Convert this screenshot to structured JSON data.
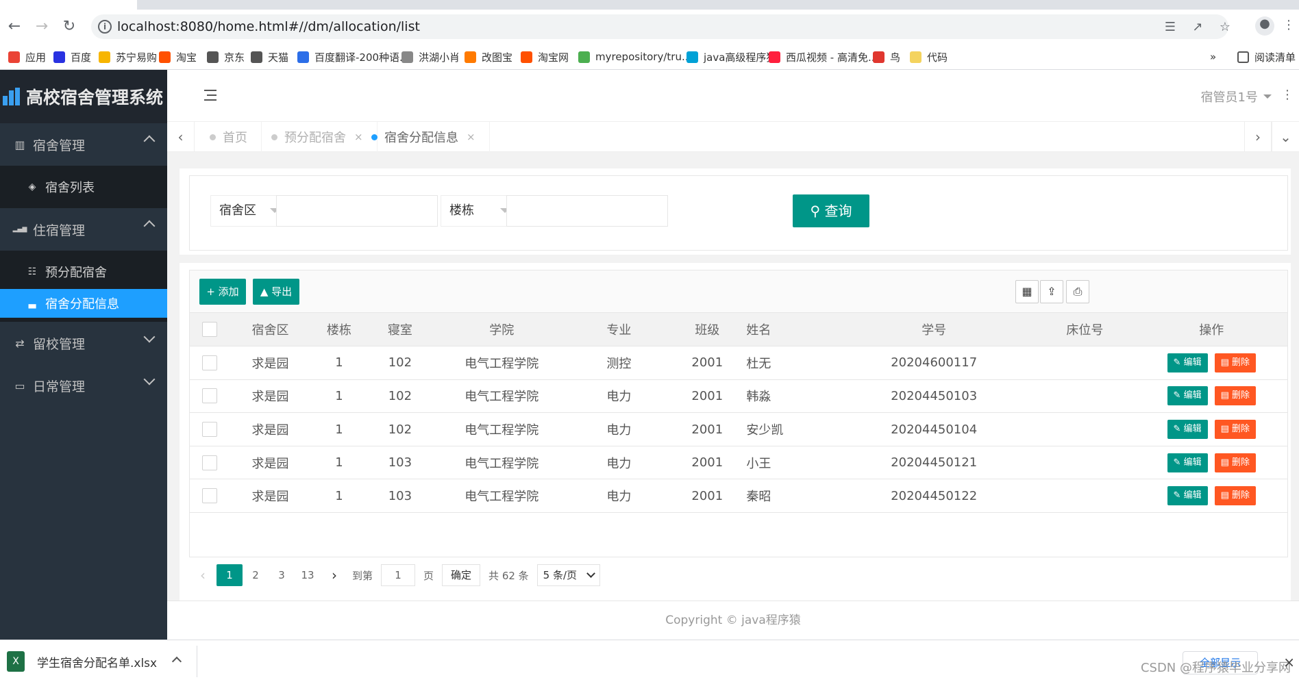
{
  "browser": {
    "url": "localhost:8080/home.html#//dm/allocation/list",
    "bookmarks": [
      {
        "label": "应用",
        "color": "#ea4335"
      },
      {
        "label": "百度",
        "color": "#2932e1"
      },
      {
        "label": "苏宁易购",
        "color": "#f7b500"
      },
      {
        "label": "淘宝",
        "color": "#ff5000"
      },
      {
        "label": "京东",
        "color": "#555555"
      },
      {
        "label": "天猫",
        "color": "#555555"
      },
      {
        "label": "百度翻译-200种语...",
        "color": "#2c6ee8"
      },
      {
        "label": "洪湖小肖",
        "color": "#888888"
      },
      {
        "label": "改图宝",
        "color": "#ff7a00"
      },
      {
        "label": "淘宝网",
        "color": "#ff5000"
      },
      {
        "label": "myrepository/tru...",
        "color": "#4caf50"
      },
      {
        "label": "java高级程序猿",
        "color": "#00a1d6"
      },
      {
        "label": "西瓜视频 - 高清免...",
        "color": "#ff1f3d"
      },
      {
        "label": "鸟",
        "color": "#e0372f"
      },
      {
        "label": "代码",
        "color": "#f4d35e"
      }
    ],
    "bookmarks_more": "»",
    "reading_list": "阅读清单"
  },
  "sidebar": {
    "app_title": "高校宿舍管理系统",
    "groups": [
      {
        "label": "宿舍管理",
        "icon": "building-icon",
        "expanded": true,
        "items": [
          {
            "label": "宿舍列表",
            "icon": "cube-icon",
            "active": false
          }
        ]
      },
      {
        "label": "住宿管理",
        "icon": "signal-icon",
        "expanded": true,
        "items": [
          {
            "label": "预分配宿舍",
            "icon": "list-icon",
            "active": false
          },
          {
            "label": "宿舍分配信息",
            "icon": "bed-icon",
            "active": true
          }
        ]
      },
      {
        "label": "留校管理",
        "icon": "swap-icon",
        "expanded": false,
        "items": []
      },
      {
        "label": "日常管理",
        "icon": "laptop-icon",
        "expanded": false,
        "items": []
      }
    ]
  },
  "header": {
    "user": "宿管员1号"
  },
  "page_tabs": [
    {
      "label": "首页",
      "closable": false,
      "active": false
    },
    {
      "label": "预分配宿舍",
      "closable": true,
      "active": false
    },
    {
      "label": "宿舍分配信息",
      "closable": true,
      "active": true
    }
  ],
  "search": {
    "area_select": "宿舍区",
    "area_value": "",
    "building_select": "楼栋",
    "building_value": "",
    "query_button": "查询"
  },
  "toolbar": {
    "add": "添加",
    "export": "导出"
  },
  "table": {
    "columns": [
      "宿舍区",
      "楼栋",
      "寝室",
      "学院",
      "专业",
      "班级",
      "姓名",
      "学号",
      "床位号",
      "操作"
    ],
    "rows": [
      {
        "area": "求是园",
        "building": "1",
        "room": "102",
        "college": "电气工程学院",
        "major": "测控",
        "class": "2001",
        "name": "杜无",
        "id": "20204600117",
        "bed": ""
      },
      {
        "area": "求是园",
        "building": "1",
        "room": "102",
        "college": "电气工程学院",
        "major": "电力",
        "class": "2001",
        "name": "韩淼",
        "id": "20204450103",
        "bed": ""
      },
      {
        "area": "求是园",
        "building": "1",
        "room": "102",
        "college": "电气工程学院",
        "major": "电力",
        "class": "2001",
        "name": "安少凯",
        "id": "20204450104",
        "bed": ""
      },
      {
        "area": "求是园",
        "building": "1",
        "room": "103",
        "college": "电气工程学院",
        "major": "电力",
        "class": "2001",
        "name": "小王",
        "id": "20204450121",
        "bed": ""
      },
      {
        "area": "求是园",
        "building": "1",
        "room": "103",
        "college": "电气工程学院",
        "major": "电力",
        "class": "2001",
        "name": "秦昭",
        "id": "20204450122",
        "bed": ""
      }
    ],
    "edit_label": "编辑",
    "delete_label": "删除"
  },
  "pager": {
    "pages": [
      "1",
      "2",
      "3",
      "13"
    ],
    "current": "1",
    "goto_prefix": "到第",
    "goto_value": "1",
    "goto_suffix": "页",
    "confirm": "确定",
    "total": "共 62 条",
    "page_size": "5 条/页"
  },
  "footer": {
    "copyright": "Copyright © java程序猿"
  },
  "download": {
    "file": "学生宿舍分配名单.xlsx",
    "show_all": "全部显示",
    "watermark": "CSDN @程序猿毕业分享网"
  }
}
